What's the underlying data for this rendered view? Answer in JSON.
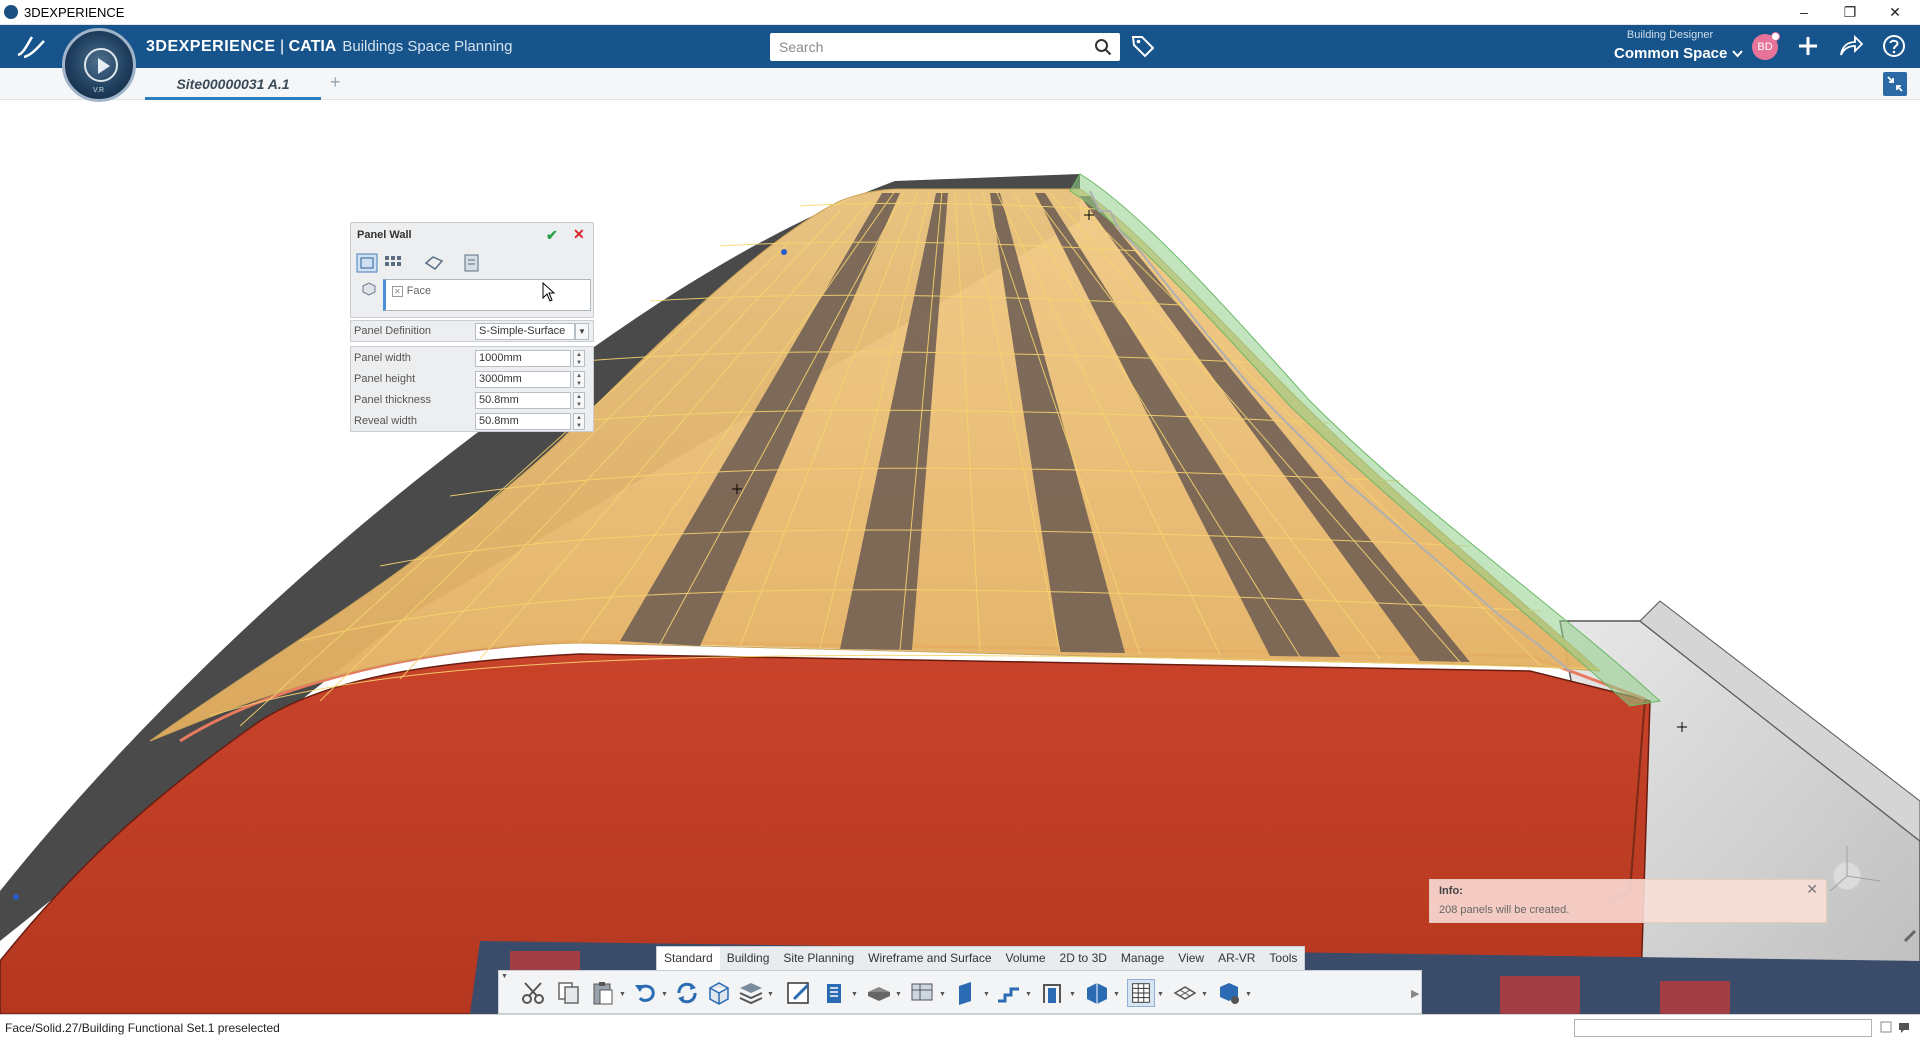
{
  "os": {
    "title": "3DEXPERIENCE",
    "min": "–",
    "restore": "❐",
    "close": "✕"
  },
  "app": {
    "brand_primary": "3DEXPERIENCE",
    "brand_sep": " | ",
    "brand_secondary": "CATIA",
    "app_name": "Buildings Space Planning",
    "search_placeholder": "Search",
    "role": "Building Designer",
    "space": "Common Space",
    "avatar": "BD",
    "compass_label": "V.R"
  },
  "document": {
    "tab_label": "Site00000031 A.1",
    "add_tab": "+"
  },
  "panel_dialog": {
    "title": "Panel Wall",
    "face_selection": "Face",
    "panel_definition_label": "Panel Definition",
    "panel_definition_value": "S-Simple-Surface",
    "params": [
      {
        "label": "Panel width",
        "value": "1000mm"
      },
      {
        "label": "Panel height",
        "value": "3000mm"
      },
      {
        "label": "Panel thickness",
        "value": "50.8mm"
      },
      {
        "label": "Reveal width",
        "value": "50.8mm"
      }
    ]
  },
  "info": {
    "title": "Info:",
    "message": "208 panels will be created."
  },
  "action_bar": {
    "tabs": [
      "Standard",
      "Building",
      "Site Planning",
      "Wireframe and Surface",
      "Volume",
      "2D to 3D",
      "Manage",
      "View",
      "AR-VR",
      "Tools"
    ],
    "active_tab": "Standard"
  },
  "status": {
    "text": "Face/Solid.27/Building Functional Set.1 preselected"
  },
  "colors": {
    "topbar": "#16548b",
    "roof": "#c6402a",
    "panel_fill": "#e8b86a",
    "panel_grid": "#f3d070",
    "panel_dark": "#6f5a50",
    "selection_green": "#8fd08a"
  }
}
